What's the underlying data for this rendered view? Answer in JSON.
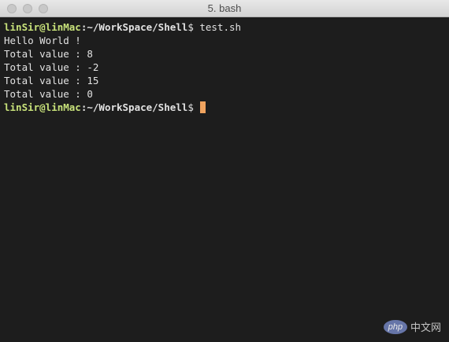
{
  "window": {
    "title": "5. bash"
  },
  "terminal": {
    "prompt1": {
      "user_host": "linSir@linMac",
      "sep": ":",
      "path": "~/WorkSpace/Shell",
      "symbol": "$",
      "command": " test.sh"
    },
    "output": [
      "Hello World !",
      "Total value : 8",
      "Total value : -2",
      "Total value : 15",
      "Total value : 0"
    ],
    "prompt2": {
      "user_host": "linSir@linMac",
      "sep": ":",
      "path": "~/WorkSpace/Shell",
      "symbol": "$ "
    }
  },
  "watermark": {
    "logo": "php",
    "text": "中文网"
  },
  "colors": {
    "background": "#1d1d1d",
    "prompt_user": "#c8e27a",
    "text": "#e2e2e2",
    "cursor": "#f0a35f"
  }
}
